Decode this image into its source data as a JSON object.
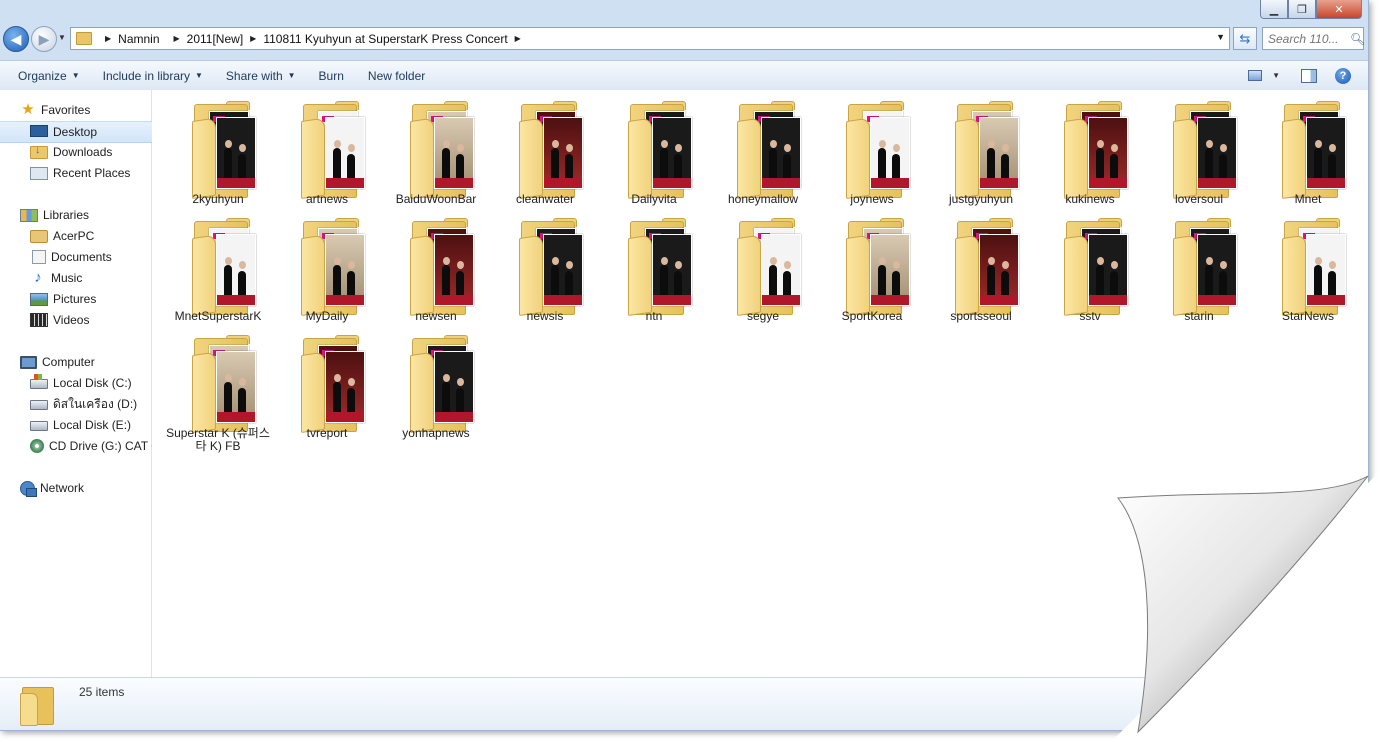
{
  "address": {
    "crumbs": [
      "Namnin",
      "2011[New]",
      "110811 Kyuhyun at SuperstarK Press Concert"
    ]
  },
  "search": {
    "placeholder": "Search 110..."
  },
  "toolbar": {
    "organize": "Organize",
    "include_in_library": "Include in library",
    "share_with": "Share with",
    "burn": "Burn",
    "new_folder": "New folder"
  },
  "nav": {
    "favorites": "Favorites",
    "desktop": "Desktop",
    "downloads": "Downloads",
    "recent_places": "Recent Places",
    "libraries": "Libraries",
    "acerpc": "AcerPC",
    "documents": "Documents",
    "music": "Music",
    "pictures": "Pictures",
    "videos": "Videos",
    "computer": "Computer",
    "local_disk_c": "Local Disk (C:)",
    "disk_d": "ดิสในเครือง (D:)",
    "local_disk_e": "Local Disk (E:)",
    "cd_drive": "CD Drive (G:) CAT C",
    "network": "Network"
  },
  "folders": [
    "2kyuhyun",
    "artnews",
    "BaiduWoonBar",
    "cleanwater",
    "Dailyvita",
    "honeymallow",
    "joynews",
    "justgyuhyun",
    "kukinews",
    "loversoul",
    "Mnet",
    "MnetSuperstarK",
    "MyDaily",
    "newsen",
    "newsis",
    "ntn",
    "segye",
    "SportKorea",
    "sportsseoul",
    "sstv",
    "starin",
    "StarNews",
    "Superstar K (슈퍼스타 K) FB",
    "tvreport",
    "yonhapnews"
  ],
  "status": {
    "item_count": "25 items"
  },
  "colors": {
    "accent": "#1d5db5",
    "folder": "#e9c66a",
    "selection": "#d1e5fb"
  }
}
